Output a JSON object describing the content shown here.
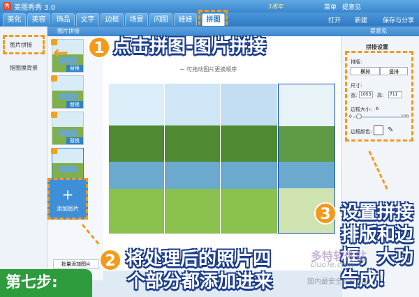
{
  "app": {
    "title": "美图秀秀 3.0",
    "logo": "秀"
  },
  "tabs": [
    "美化",
    "美容",
    "饰品",
    "文字",
    "边框",
    "场景",
    "闪图",
    "娃娃",
    "拼图"
  ],
  "topright": {
    "menu": "菜单",
    "user": "提意见",
    "open": "打开",
    "new": "新建",
    "save": "保存与分享",
    "anniversary": "3周年"
  },
  "left_panel": {
    "items": [
      "图片拼接",
      "抠图换背景"
    ]
  },
  "thumbs": {
    "replace_label": "替换",
    "add_label": "添加图片",
    "batch_label": "批量添加图片"
  },
  "canvas": {
    "header": "图片拼接",
    "hint": "← 可拖动图片更换顺序"
  },
  "right_panel": {
    "header": "提意见",
    "title": "拼接设置",
    "layout_label": "排版:",
    "layout_options": [
      "横排",
      "竖排"
    ],
    "size_label": "尺寸:",
    "width_label": "宽:",
    "width_value": "1053",
    "height_label": "高:",
    "height_value": "711",
    "border_size_label": "边框大小:",
    "border_size_value": "6",
    "slider_min": "0",
    "slider_max": "100",
    "border_color_label": "边框颜色:"
  },
  "callouts": {
    "c1_num": "1",
    "c1_text": "点击拼图-图片拼接",
    "c2_num": "2",
    "c2_line1": "将处理后的照片四",
    "c2_line2": "个部分都添加进来",
    "c3_num": "3",
    "c3_line1": "设置拼接",
    "c3_line2": "排版和边",
    "c3_line3": "框，大功",
    "c3_line4": "告成！"
  },
  "step_label": "第七步:",
  "watermark": {
    "brand": "多特软件站",
    "url": "DuoTe.com",
    "site": "国内最安全的软件站"
  },
  "colors": {
    "accent": "#f39a1c",
    "brand_blue": "#3b86cf",
    "step_green": "#2e9b3c"
  }
}
